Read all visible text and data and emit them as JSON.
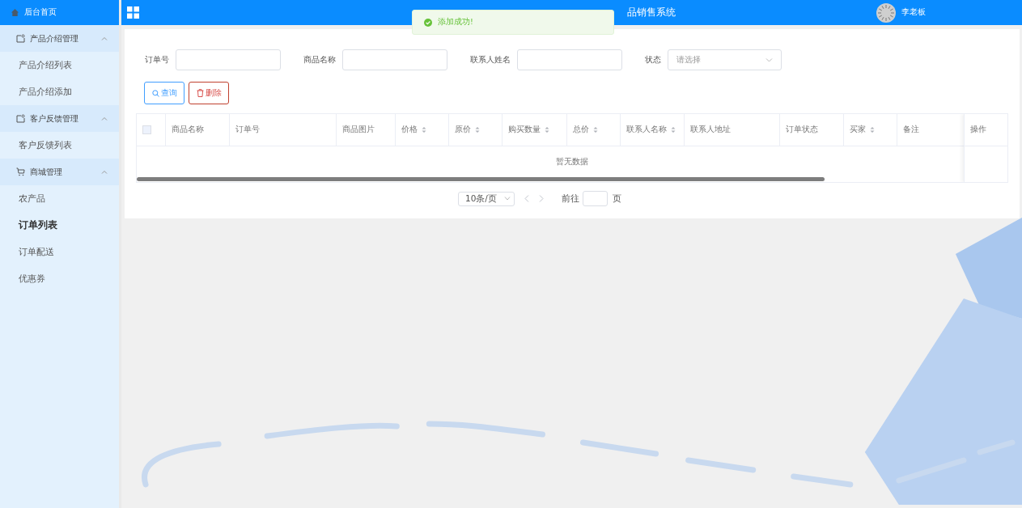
{
  "sidebar": {
    "home": {
      "label": "后台首页"
    },
    "groups": [
      {
        "label": "产品介绍管理",
        "kind": "note",
        "expanded": true,
        "items": [
          {
            "label": "产品介绍列表",
            "selected": false
          },
          {
            "label": "产品介绍添加",
            "selected": false
          }
        ]
      },
      {
        "label": "客户反馈管理",
        "kind": "note",
        "expanded": true,
        "items": [
          {
            "label": "客户反馈列表",
            "selected": false
          }
        ]
      },
      {
        "label": "商城管理",
        "kind": "cart",
        "expanded": true,
        "items": [
          {
            "label": "农产品",
            "selected": false
          },
          {
            "label": "订单列表",
            "selected": true
          },
          {
            "label": "订单配送",
            "selected": false
          },
          {
            "label": "优惠券",
            "selected": false
          }
        ]
      }
    ]
  },
  "header": {
    "title": "品销售系统",
    "user": "李老板"
  },
  "toast": {
    "message": "添加成功!"
  },
  "filters": [
    {
      "kind": "text",
      "label": "订单号"
    },
    {
      "kind": "text",
      "label": "商品名称"
    },
    {
      "kind": "text",
      "label": "联系人姓名"
    },
    {
      "kind": "select",
      "label": "状态",
      "placeholder": "请选择"
    }
  ],
  "actions": [
    {
      "kind": "search",
      "label": "查询"
    },
    {
      "kind": "delete",
      "label": "删除"
    }
  ],
  "table": {
    "select_all": {
      "checked": false
    },
    "columns": [
      {
        "label": "商品名称",
        "sortable": false
      },
      {
        "label": "订单号",
        "sortable": false
      },
      {
        "label": "商品图片",
        "sortable": false
      },
      {
        "label": "价格",
        "sortable": true
      },
      {
        "label": "原价",
        "sortable": true
      },
      {
        "label": "购买数量",
        "sortable": true
      },
      {
        "label": "总价",
        "sortable": true
      },
      {
        "label": "联系人名称",
        "sortable": true
      },
      {
        "label": "联系人地址",
        "sortable": false
      },
      {
        "label": "订单状态",
        "sortable": false
      },
      {
        "label": "买家",
        "sortable": true
      },
      {
        "label": "备注",
        "sortable": false
      }
    ],
    "fixed_column": "操作",
    "empty_text": "暂无数据"
  },
  "pagination": {
    "page_size": "10条/页",
    "goto_label": "前往",
    "page_unit": "页"
  }
}
